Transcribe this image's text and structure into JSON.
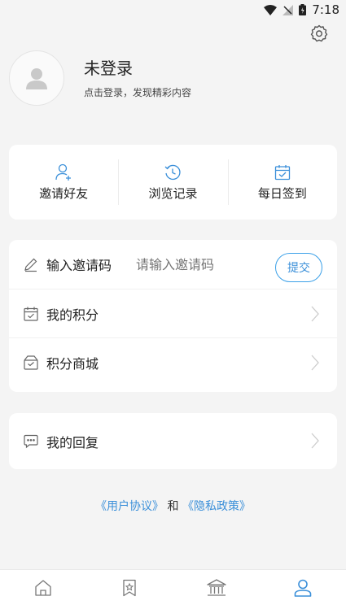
{
  "status_bar": {
    "time": "7:18"
  },
  "profile": {
    "name": "未登录",
    "subtitle": "点击登录，发现精彩内容"
  },
  "quick_actions": [
    {
      "label": "邀请好友",
      "icon": "invite-user-icon"
    },
    {
      "label": "浏览记录",
      "icon": "history-icon"
    },
    {
      "label": "每日签到",
      "icon": "calendar-check-icon"
    }
  ],
  "menu": {
    "invite": {
      "label": "输入邀请码",
      "placeholder": "请输入邀请码",
      "submit_label": "提交"
    },
    "points": {
      "label": "我的积分"
    },
    "shop": {
      "label": "积分商城"
    }
  },
  "reply": {
    "label": "我的回复"
  },
  "agreement": {
    "user_agreement": "《用户协议》",
    "and": "和",
    "privacy_policy": "《隐私政策》"
  },
  "tabs": [
    {
      "icon": "home-icon"
    },
    {
      "icon": "bookmark-star-icon"
    },
    {
      "icon": "bank-icon"
    },
    {
      "icon": "user-icon",
      "active": true
    }
  ],
  "colors": {
    "accent": "#3a8fd9",
    "background": "#f4f4f4",
    "card": "#ffffff"
  }
}
